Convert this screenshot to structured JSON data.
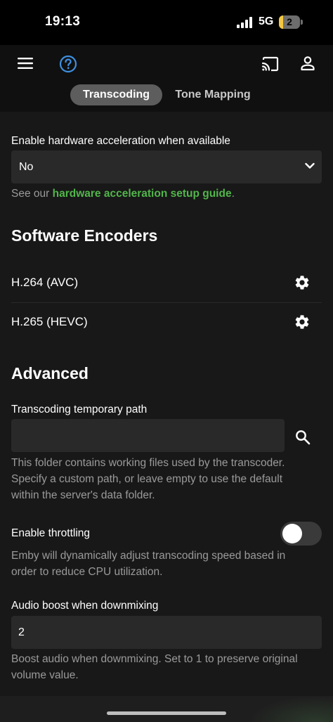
{
  "status": {
    "time": "19:13",
    "network": "5G",
    "battery": {
      "level": "2",
      "percent": 0.2
    }
  },
  "header": {
    "tabs": [
      {
        "label": "Transcoding",
        "active": true
      },
      {
        "label": "Tone Mapping",
        "active": false
      }
    ],
    "icons": [
      "menu-icon",
      "help-icon",
      "cast-icon",
      "user-icon"
    ]
  },
  "hw_accel": {
    "label": "Enable hardware acceleration when available",
    "value": "No",
    "help_prefix": "See our ",
    "help_link": "hardware acceleration setup guide",
    "help_suffix": "."
  },
  "software_encoders": {
    "title": "Software Encoders",
    "items": [
      {
        "label": "H.264 (AVC)",
        "icon": "gear-icon"
      },
      {
        "label": "H.265 (HEVC)",
        "icon": "gear-icon"
      }
    ]
  },
  "advanced": {
    "title": "Advanced",
    "temp_path": {
      "label": "Transcoding temporary path",
      "value": "",
      "help_lines": [
        "This folder contains working files used by the transcoder.",
        "Specify a custom path, or leave empty to use the default",
        "within the server's data folder."
      ]
    },
    "throttling": {
      "label": "Enable throttling",
      "enabled": false,
      "help_lines": [
        "Emby will dynamically adjust transcoding speed based in",
        "order to reduce CPU utilization."
      ]
    },
    "audio_boost": {
      "label": "Audio boost when downmixing",
      "value": "2",
      "help_lines": [
        "Boost audio when downmixing. Set to 1 to preserve original",
        "volume value."
      ]
    }
  },
  "colors": {
    "accent_link": "#52b54b",
    "help_icon": "#3f8fe0",
    "background": "#181818",
    "field": "#292929"
  }
}
